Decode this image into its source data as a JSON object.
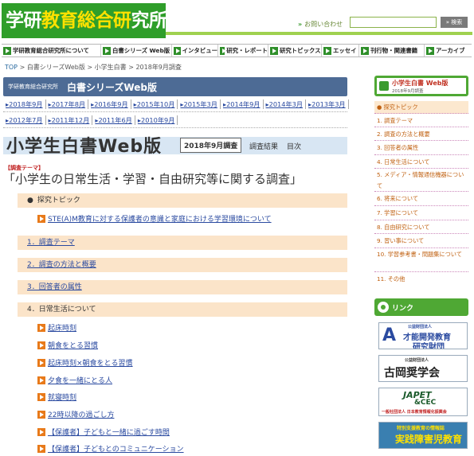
{
  "header": {
    "logo_part1": "学研",
    "logo_part2": "教育総合",
    "logo_part3": "研",
    "logo_part4": "究所",
    "contact_arrow": "»",
    "contact": "お問い合わせ",
    "search_placeholder": "",
    "search_button": "» 検索"
  },
  "gnav": [
    "学研教育総合研究所について",
    "白書シリーズ Web版",
    "インタビュー",
    "研究・レポート",
    "研究トピックス",
    "エッセイ",
    "刊行物・関連書籍",
    "アーカイブ"
  ],
  "breadcrumb": {
    "top": "TOP",
    "sep": ">",
    "c1": "白書シリーズWeb版",
    "c2": "小学生白書",
    "c3": "2018年9月調査"
  },
  "hbar": {
    "small": "学研教育総合研究所",
    "title": "白書シリーズWeb版"
  },
  "years_row1": [
    "2018年9月",
    "2017年8月",
    "2016年9月",
    "2015年10月",
    "2015年3月",
    "2014年9月",
    "2014年3月",
    "2013年3月"
  ],
  "years_row2": [
    "2012年7月",
    "2011年12月",
    "2011年6月",
    "2010年9月"
  ],
  "title": {
    "big": "小学生白書Web版",
    "badge": "2018年9月調査",
    "results": "調査結果",
    "toc": "目次"
  },
  "theme_label": "【調査テーマ】",
  "theme": "「小学生の日常生活・学習・自由研究等に関する調査」",
  "sections": {
    "topic": "探究トピック",
    "topic_link": "STE(A)M教育に対する保護者の意識と家庭における学習環境について",
    "s1": "1．調査テーマ",
    "s2": "2．調査の方法と概要",
    "s3": "3．回答者の属性",
    "s4": "4．日常生活について"
  },
  "items": [
    "起床時刻",
    "朝食をとる習慣",
    "起床時刻×朝食をとる習慣",
    "夕食を一緒にとる人",
    "就寝時刻",
    "22時以降の過ごし方",
    "【保護者】子どもと一緒に過ごす時間",
    "【保護者】子どもとのコミュニケーション"
  ],
  "side": {
    "title": "小学生白書 Web版",
    "date": "2018年9月調査",
    "menu": [
      "● 探究トピック",
      "1. 調査テーマ",
      "2. 調査の方法と概要",
      "3. 回答者の属性",
      "4. 日常生活について",
      "5. メディア・情報通信機器について",
      "6. 将来について",
      "7. 学習について",
      "8. 自由研究について",
      "9. 習い事について",
      "10. 学習参考書・問題集について",
      "11. その他"
    ],
    "link_title": "リンク"
  },
  "banners": {
    "b1_top": "公益財団法人",
    "b1_l1": "才能開発教育",
    "b1_l2": "研究財団",
    "b2_top": "公益財団法人",
    "b2_l1": "古岡奨学会",
    "b3_l1": "JAPET",
    "b3_l2": "&CEC",
    "b3_l3": "一般社団法人 日本教育情報化振興会",
    "b4_l1": "特別支援教育の情報誌",
    "b4_l2": "実践障害児教育"
  },
  "colors": {
    "brand_green": "#2f9e2a",
    "logo_yellow": "#ffe100",
    "header_blue": "#4d6b95",
    "section_bg": "#fbe4c9",
    "link_blue": "#2a4aa0",
    "item_icon_orange": "#e87a1a"
  }
}
